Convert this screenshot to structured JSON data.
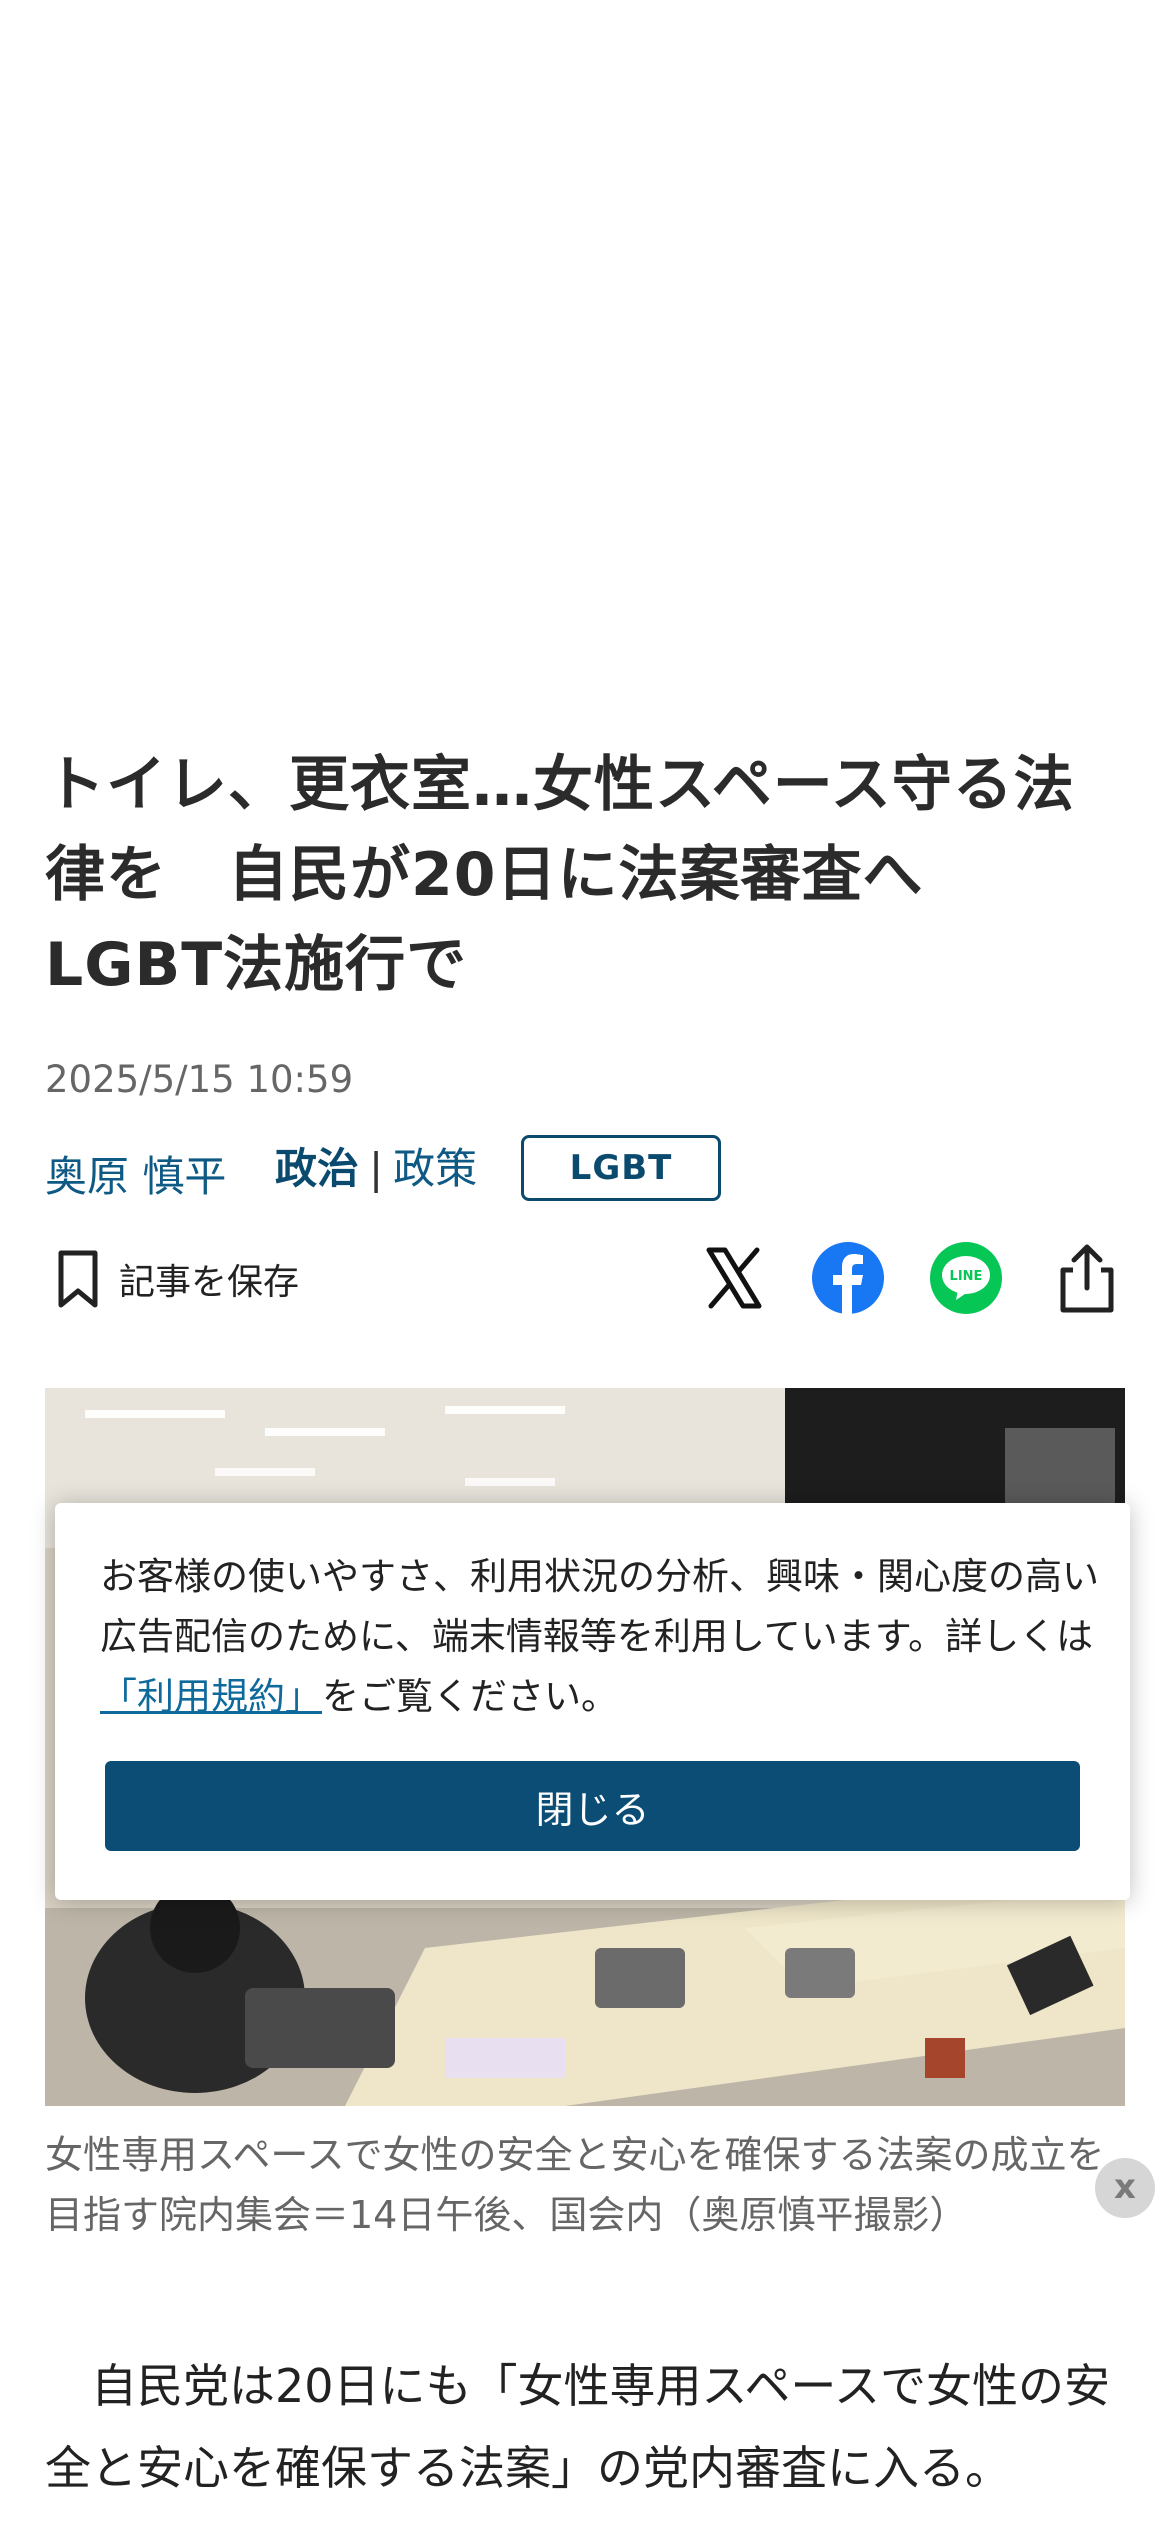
{
  "article": {
    "headline": "トイレ、更衣室…女性スペース守る法律を　自民が20日に法案審査へ　LGBT法施行で",
    "date": "2025/5/15 10:59",
    "author": "奥原 慎平",
    "category_main": "政治",
    "category_separator": "|",
    "category_sub": "政策",
    "tag": "LGBT",
    "photo_caption": "女性専用スペースで女性の安全と安心を確保する法案の成立を目指す院内集会＝14日午後、国会内（奥原慎平撮影）",
    "caption_close": "x",
    "body_start": "　自民党は20日にも「女性専用スペースで女性の安全と安心を確保する法案」の党内審査に入る。"
  },
  "actions": {
    "save_label": "記事を保存",
    "share_icons": [
      "x-logo-icon",
      "facebook-icon",
      "line-icon",
      "share-icon"
    ]
  },
  "consent": {
    "text_before": "お客様の使いやすさ、利用状況の分析、興味・関心度の高い広告配信のために、端末情報等を利用しています。詳しくは",
    "link_text": "「利用規約」",
    "text_after": "をご覧ください。",
    "close_label": "閉じる"
  },
  "colors": {
    "accent": "#0b4d74",
    "link": "#0f6a9c",
    "facebook": "#1877f2",
    "line": "#06c755"
  }
}
